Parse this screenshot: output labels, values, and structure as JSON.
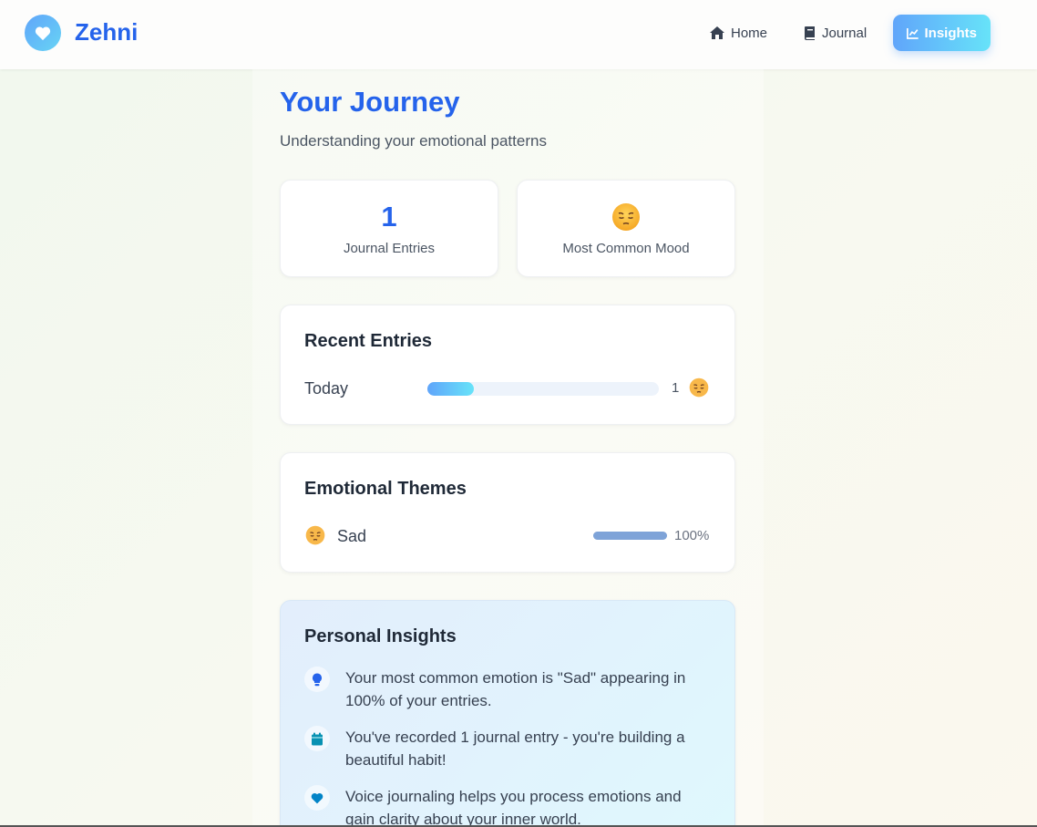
{
  "brand": {
    "name": "Zehni",
    "logo_icon": "heart-icon"
  },
  "nav": {
    "items": [
      {
        "label": "Home",
        "icon": "home-icon",
        "active": false
      },
      {
        "label": "Journal",
        "icon": "book-icon",
        "active": false
      },
      {
        "label": "Insights",
        "icon": "chart-line-icon",
        "active": true
      }
    ]
  },
  "page": {
    "title": "Your Journey",
    "subtitle": "Understanding your emotional patterns"
  },
  "stats": {
    "entries_count": "1",
    "entries_label": "Journal Entries",
    "mood_emoji": "pensive-face",
    "mood_label": "Most Common Mood"
  },
  "recent": {
    "title": "Recent Entries",
    "rows": [
      {
        "label": "Today",
        "count": "1",
        "fill_fraction": 0.2,
        "emoji": "pensive-face"
      }
    ]
  },
  "themes": {
    "title": "Emotional Themes",
    "rows": [
      {
        "emoji": "pensive-face",
        "label": "Sad",
        "percent": "100%",
        "fill_fraction": 1.0
      }
    ]
  },
  "insights": {
    "title": "Personal Insights",
    "items": [
      {
        "icon": "lightbulb-icon",
        "text": "Your most common emotion is \"Sad\" appearing in 100% of your entries."
      },
      {
        "icon": "calendar-icon",
        "text": "You've recorded 1 journal entry - you're building a beautiful habit!"
      },
      {
        "icon": "heart-icon",
        "text": "Voice journaling helps you process emotions and gain clarity about your inner world."
      }
    ]
  },
  "colors": {
    "accent": "#2563eb",
    "gradient_start": "#60a5fa",
    "gradient_end": "#67e3f9"
  }
}
